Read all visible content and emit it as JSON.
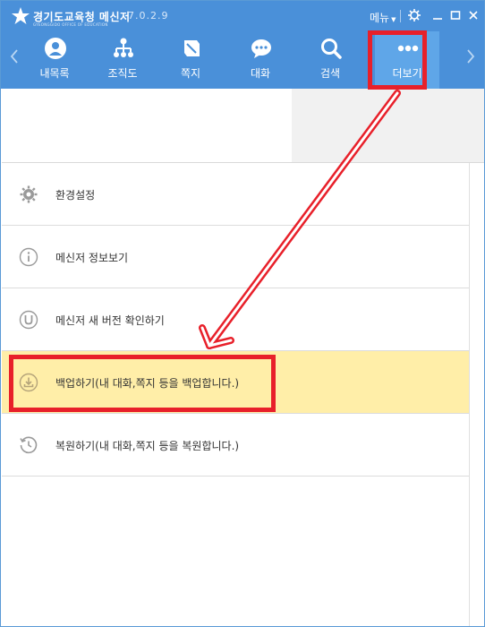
{
  "app": {
    "title": "경기도교육청 메신저",
    "subtitle": "GYEONGGIDO OFFICE OF EDUCATION",
    "version": "7.0.2.9",
    "menu_label": "메뉴"
  },
  "nav": {
    "items": [
      {
        "label": "내목록",
        "icon": "person-icon"
      },
      {
        "label": "조직도",
        "icon": "org-chart-icon"
      },
      {
        "label": "쪽지",
        "icon": "note-icon"
      },
      {
        "label": "대화",
        "icon": "chat-icon"
      },
      {
        "label": "검색",
        "icon": "search-icon"
      },
      {
        "label": "더보기",
        "icon": "more-icon",
        "active": true
      }
    ]
  },
  "menu_list": [
    {
      "label": "환경설정",
      "icon": "gear-icon"
    },
    {
      "label": "메신저 정보보기",
      "icon": "info-icon"
    },
    {
      "label": "메신저 새 버전 확인하기",
      "icon": "update-icon"
    },
    {
      "label": "백업하기(내 대화,쪽지 등을 백업합니다.)",
      "icon": "backup-icon",
      "highlighted": true
    },
    {
      "label": "복원하기(내 대화,쪽지 등을 복원합니다.)",
      "icon": "restore-icon"
    }
  ],
  "colors": {
    "header_blue": "#4a90d9",
    "active_tab": "#5fa6e8",
    "highlight_row": "#ffeea8",
    "annotation_red": "#e8202a"
  }
}
